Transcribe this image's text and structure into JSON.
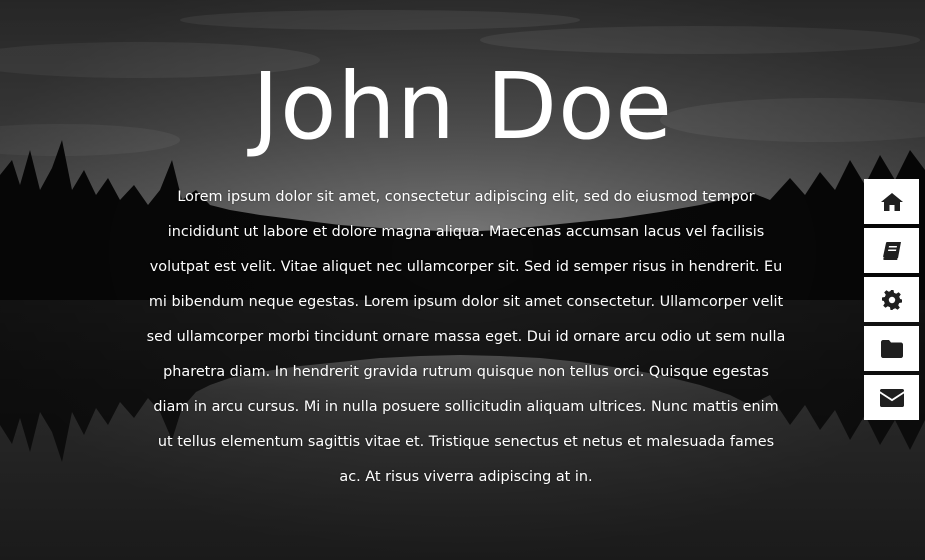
{
  "hero": {
    "title": "John Doe",
    "text": "Lorem ipsum dolor sit amet, consectetur adipiscing elit, sed do eiusmod tempor incididunt ut labore et dolore magna aliqua. Maecenas accumsan lacus vel facilisis volutpat est velit. Vitae aliquet nec ullamcorper sit. Sed id semper risus in hendrerit. Eu mi bibendum neque egestas. Lorem ipsum dolor sit amet consectetur. Ullamcorper velit sed ullamcorper morbi tincidunt ornare massa eget. Dui id ornare arcu odio ut sem nulla pharetra diam. In hendrerit gravida rutrum quisque non tellus orci. Quisque egestas diam in arcu cursus. Mi in nulla posuere sollicitudin aliquam ultrices. Nunc mattis enim ut tellus elementum sagittis vitae et. Tristique senectus et netus et malesuada fames ac. At risus viverra adipiscing at in."
  },
  "sidenav": {
    "items": [
      {
        "icon": "home-icon"
      },
      {
        "icon": "book-icon"
      },
      {
        "icon": "gear-icon"
      },
      {
        "icon": "folder-icon"
      },
      {
        "icon": "envelope-icon"
      }
    ]
  },
  "colors": {
    "nav_background": "#ffffff",
    "nav_icon": "#1f1f1f",
    "text": "#ffffff"
  }
}
